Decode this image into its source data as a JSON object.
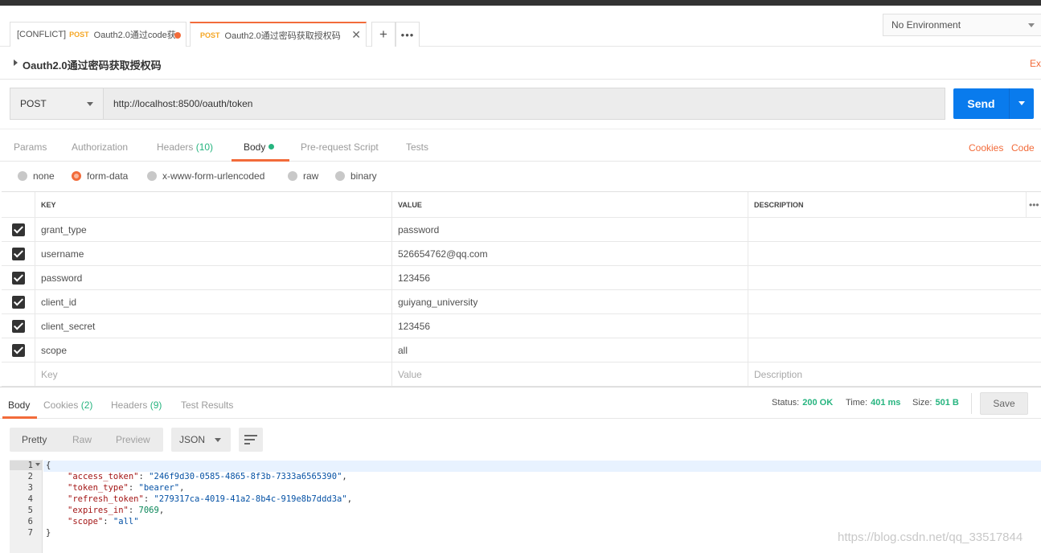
{
  "tabs": [
    {
      "prefix": "[CONFLICT]",
      "method": "POST",
      "name": "Oauth2.0通过code获"
    },
    {
      "method": "POST",
      "name": "Oauth2.0通过密码获取授权码"
    }
  ],
  "environment": "No Environment",
  "request": {
    "title": "Oauth2.0通过密码获取授权码",
    "ex_link": "Ex",
    "method": "POST",
    "url": "http://localhost:8500/oauth/token",
    "send_label": "Send"
  },
  "request_tabs": {
    "params": "Params",
    "authorization": "Authorization",
    "headers": "Headers",
    "headers_count": "(10)",
    "body": "Body",
    "pre_request": "Pre-request Script",
    "tests": "Tests",
    "cookies": "Cookies",
    "code": "Code"
  },
  "body_types": [
    "none",
    "form-data",
    "x-www-form-urlencoded",
    "raw",
    "binary"
  ],
  "body_type_selected": "form-data",
  "params_table": {
    "columns": [
      "KEY",
      "VALUE",
      "DESCRIPTION"
    ],
    "more": "•••",
    "rows": [
      {
        "key": "grant_type",
        "value": "password"
      },
      {
        "key": "username",
        "value": "526654762@qq.com"
      },
      {
        "key": "password",
        "value": "123456"
      },
      {
        "key": "client_id",
        "value": "guiyang_university"
      },
      {
        "key": "client_secret",
        "value": "123456"
      },
      {
        "key": "scope",
        "value": "all"
      }
    ],
    "placeholders": {
      "key": "Key",
      "value": "Value",
      "description": "Description"
    }
  },
  "response_tabs": {
    "body": "Body",
    "cookies": "Cookies",
    "cookies_count": "(2)",
    "headers": "Headers",
    "headers_count": "(9)",
    "test_results": "Test Results"
  },
  "response_status": {
    "status_label": "Status:",
    "status_value": "200 OK",
    "time_label": "Time:",
    "time_value": "401 ms",
    "size_label": "Size:",
    "size_value": "501 B",
    "save_label": "Save"
  },
  "view_modes": [
    "Pretty",
    "Raw",
    "Preview"
  ],
  "format": "JSON",
  "response_body": {
    "line_numbers": [
      "1",
      "2",
      "3",
      "4",
      "5",
      "6",
      "7"
    ],
    "open_brace": "{",
    "close_brace": "}",
    "fields": [
      {
        "key": "\"access_token\"",
        "value": "\"246f9d30-0585-4865-8f3b-7333a6565390\"",
        "type": "string",
        "comma": ","
      },
      {
        "key": "\"token_type\"",
        "value": "\"bearer\"",
        "type": "string",
        "comma": ","
      },
      {
        "key": "\"refresh_token\"",
        "value": "\"279317ca-4019-41a2-8b4c-919e8b7ddd3a\"",
        "type": "string",
        "comma": ","
      },
      {
        "key": "\"expires_in\"",
        "value": "7069",
        "type": "number",
        "comma": ","
      },
      {
        "key": "\"scope\"",
        "value": "\"all\"",
        "type": "string",
        "comma": ""
      }
    ]
  },
  "watermark": "https://blog.csdn.net/qq_33517844",
  "colors": {
    "accent": "#f26b3a",
    "send": "#097bed",
    "success": "#26b47f"
  }
}
